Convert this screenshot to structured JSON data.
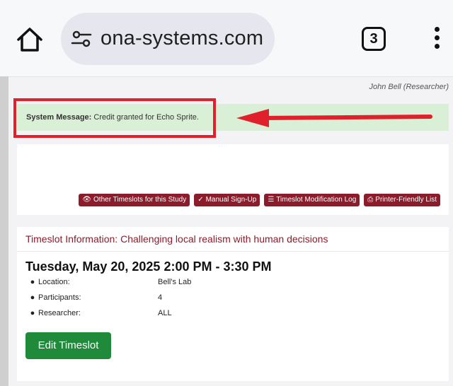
{
  "browser": {
    "url": "ona-systems.com",
    "tab_count": "3"
  },
  "page": {
    "researcher": "John Bell (Researcher)",
    "system_message": {
      "label": "System Message:",
      "text": "Credit granted for Echo Sprite."
    },
    "actions": [
      {
        "label": "Other Timeslots for this Study",
        "icon": "eye-icon"
      },
      {
        "label": "Manual Sign-Up",
        "icon": "check-icon"
      },
      {
        "label": "Timeslot Modification Log",
        "icon": "list-icon"
      },
      {
        "label": "Printer-Friendly List",
        "icon": "printer-icon"
      }
    ],
    "timeslot": {
      "header_label": "Timeslot Information:",
      "study_title": "Challenging local realism with human decisions",
      "datetime": "Tuesday, May 20, 2025 2:00 PM - 3:30 PM",
      "details": [
        {
          "label": "Location:",
          "value": "Bell's Lab",
          "icon": "map-marker-icon"
        },
        {
          "label": "Participants:",
          "value": "4",
          "icon": "users-icon"
        },
        {
          "label": "Researcher:",
          "value": "ALL",
          "icon": "user-icon"
        }
      ],
      "edit_button": "Edit Timeslot"
    }
  },
  "colors": {
    "accent": "#8b1c2c",
    "success_bg": "#d9efd6",
    "edit_button": "#1f8a3a",
    "annotation": "#e0202a"
  }
}
